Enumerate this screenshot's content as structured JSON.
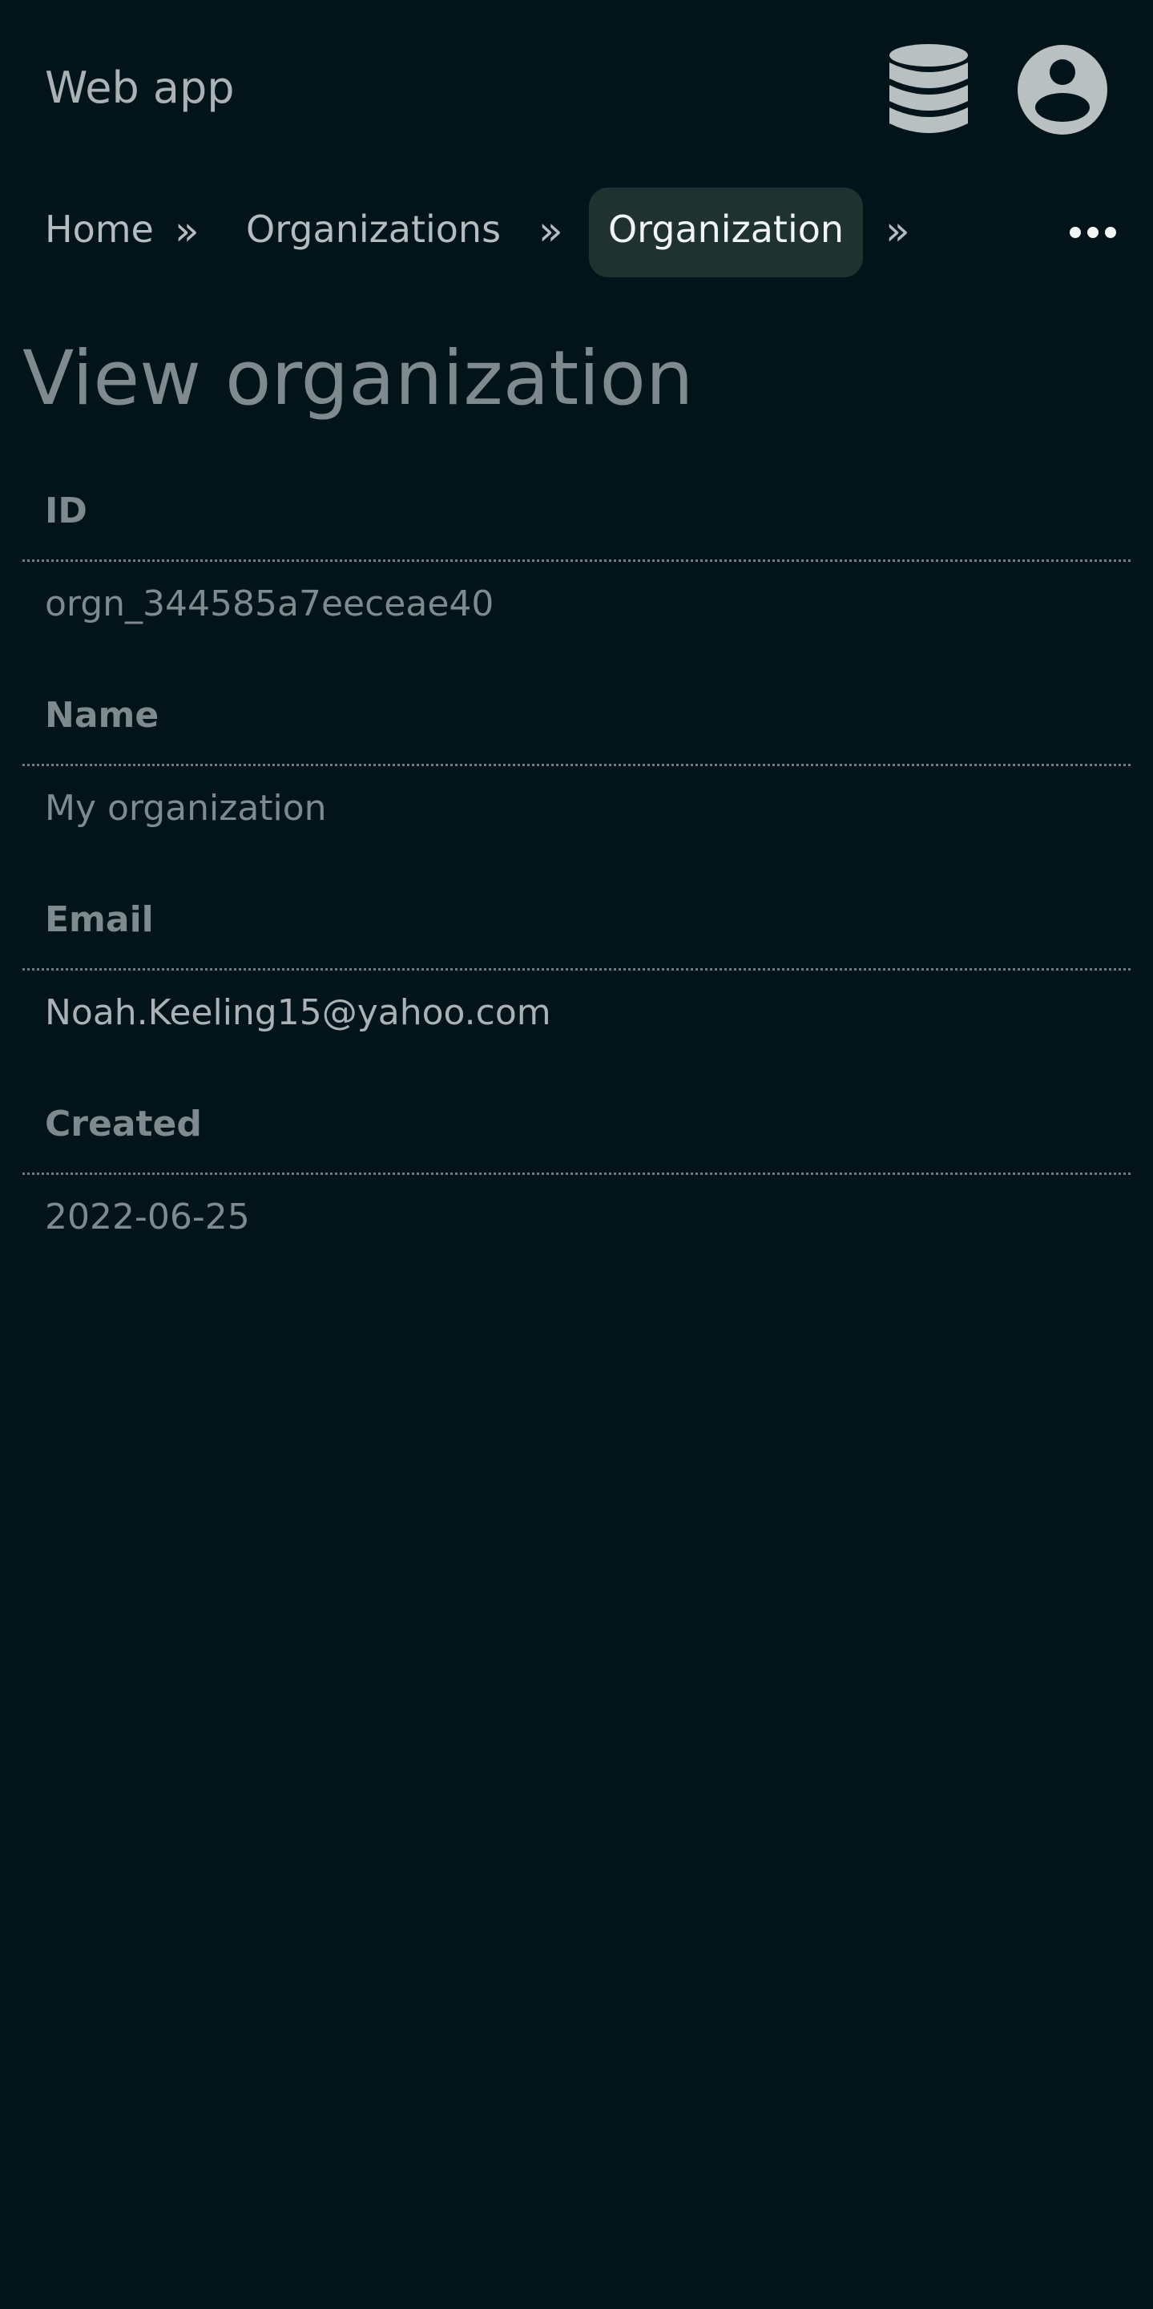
{
  "header": {
    "app_title": "Web app",
    "icons": [
      "database-icon",
      "user-avatar-icon"
    ]
  },
  "breadcrumb": {
    "items": [
      {
        "label": "Home"
      },
      {
        "label": "Organizations"
      },
      {
        "label": "Organization",
        "active": true
      }
    ],
    "separator": "»",
    "more_icon": "ellipsis-icon"
  },
  "page": {
    "title": "View organization"
  },
  "fields": [
    {
      "label": "ID",
      "value": "orgn_344585a7eeceae40"
    },
    {
      "label": "Name",
      "value": "My organization"
    },
    {
      "label": "Email",
      "value": "Noah.Keeling15@yahoo.com"
    },
    {
      "label": "Created",
      "value": "2022-06-25"
    }
  ],
  "colors": {
    "background": "#02131a",
    "active_crumb_bg": "#1f3230",
    "text_muted": "#7f8a8e",
    "text_light": "#aab2b6"
  }
}
